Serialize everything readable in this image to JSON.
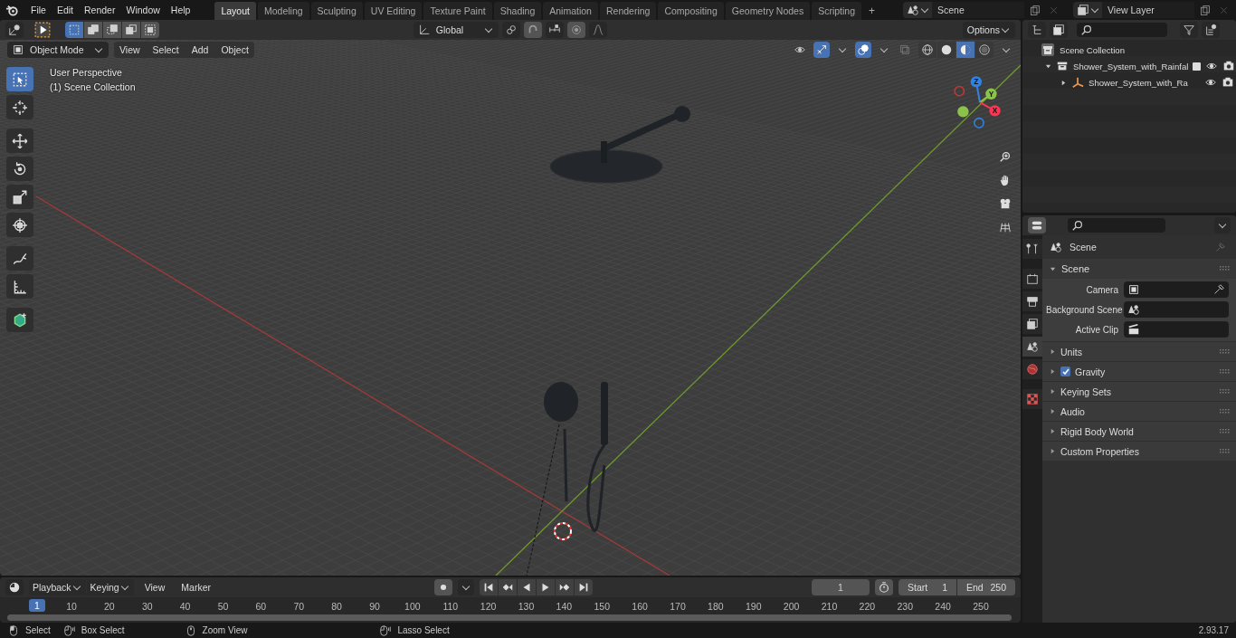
{
  "menu": [
    "File",
    "Edit",
    "Render",
    "Window",
    "Help"
  ],
  "workspaces": [
    {
      "label": "Layout",
      "selected": true
    },
    {
      "label": "Modeling",
      "selected": false
    },
    {
      "label": "Sculpting",
      "selected": false
    },
    {
      "label": "UV Editing",
      "selected": false
    },
    {
      "label": "Texture Paint",
      "selected": false
    },
    {
      "label": "Shading",
      "selected": false
    },
    {
      "label": "Animation",
      "selected": false
    },
    {
      "label": "Rendering",
      "selected": false
    },
    {
      "label": "Compositing",
      "selected": false
    },
    {
      "label": "Geometry Nodes",
      "selected": false
    },
    {
      "label": "Scripting",
      "selected": false
    }
  ],
  "add_workspace": "+",
  "scene_field": {
    "value": "Scene"
  },
  "view_layer_field": {
    "value": "View Layer"
  },
  "viewport": {
    "select_modes": [
      {
        "kind": "new",
        "selected": true
      },
      {
        "kind": "extend",
        "selected": false
      },
      {
        "kind": "subtract",
        "selected": false
      },
      {
        "kind": "invert",
        "selected": false
      },
      {
        "kind": "intersect",
        "selected": false
      }
    ],
    "orientation": "Global",
    "options": "Options",
    "mode": "Object Mode",
    "menus": [
      "View",
      "Select",
      "Add",
      "Object"
    ],
    "shading": [
      {
        "kind": "wireframe",
        "selected": false
      },
      {
        "kind": "solid",
        "selected": false
      },
      {
        "kind": "material",
        "selected": true
      },
      {
        "kind": "rendered",
        "selected": false
      }
    ],
    "overlay_text": [
      "User Perspective",
      "(1) Scene Collection"
    ],
    "tools": [
      {
        "kind": "select",
        "selected": true
      },
      {
        "kind": "cursor",
        "selected": false
      },
      {
        "kind": "move",
        "selected": false
      },
      {
        "kind": "rotate",
        "selected": false
      },
      {
        "kind": "scale",
        "selected": false
      },
      {
        "kind": "transform",
        "selected": false
      },
      {
        "kind": "annotate",
        "selected": false
      },
      {
        "kind": "measure",
        "selected": false
      },
      {
        "kind": "add-cube",
        "selected": false
      }
    ],
    "gizmo": [
      {
        "kind": "z",
        "label": "Z"
      },
      {
        "kind": "y",
        "label": "Y"
      },
      {
        "kind": "x",
        "label": "X"
      }
    ]
  },
  "outliner": {
    "root": "Scene Collection",
    "items": [
      {
        "label": "Shower_System_with_Rainfal",
        "expanded": true,
        "checked": true,
        "children": [
          {
            "label": "Shower_System_with_Ra",
            "expanded": false
          }
        ]
      }
    ]
  },
  "properties": {
    "tabs": [
      {
        "kind": "tool",
        "selected": false
      },
      {
        "kind": "render",
        "selected": false
      },
      {
        "kind": "output",
        "selected": false
      },
      {
        "kind": "view-layer",
        "selected": false
      },
      {
        "kind": "scene",
        "selected": true
      },
      {
        "kind": "world",
        "selected": false
      },
      {
        "kind": "texture",
        "selected": false
      }
    ],
    "context": "Scene",
    "panel": {
      "title": "Scene",
      "expanded": true,
      "fields": [
        {
          "kind": "camera",
          "label": "Camera"
        },
        {
          "kind": "scene",
          "label": "Background Scene"
        },
        {
          "kind": "clip",
          "label": "Active Clip"
        }
      ]
    },
    "sections": [
      {
        "title": "Units",
        "expanded": false
      },
      {
        "title": "Gravity",
        "expanded": false,
        "checked": true
      },
      {
        "title": "Keying Sets",
        "expanded": false
      },
      {
        "title": "Audio",
        "expanded": false
      },
      {
        "title": "Rigid Body World",
        "expanded": false
      },
      {
        "title": "Custom Properties",
        "expanded": false
      }
    ]
  },
  "timeline": {
    "dropdowns": [
      "Playback",
      "Keying"
    ],
    "menus": [
      "View",
      "Marker"
    ],
    "current_frame": "1",
    "start_label": "Start",
    "start": "1",
    "end_label": "End",
    "end": "250",
    "playhead": "1",
    "ruler": [
      "10",
      "20",
      "30",
      "40",
      "50",
      "60",
      "70",
      "80",
      "90",
      "100",
      "110",
      "120",
      "130",
      "140",
      "150",
      "160",
      "170",
      "180",
      "190",
      "200",
      "210",
      "220",
      "230",
      "240",
      "250"
    ]
  },
  "status": {
    "hints": [
      {
        "kind": "left",
        "label": "Select"
      },
      {
        "kind": "drag",
        "label": "Box Select"
      },
      {
        "kind": "middle",
        "label": "Zoom View"
      },
      {
        "kind": "drag",
        "label": "Lasso Select"
      }
    ],
    "version": "2.93.17"
  }
}
